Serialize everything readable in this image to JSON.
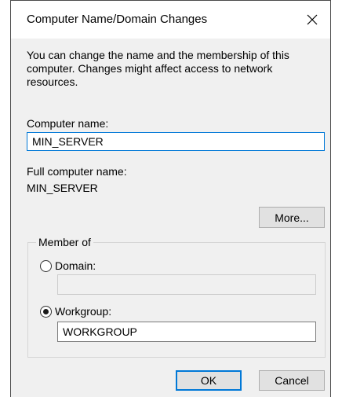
{
  "dialog": {
    "title": "Computer Name/Domain Changes",
    "close_glyph": "✕",
    "description": "You can change the name and the membership of this computer. Changes might affect access to network resources."
  },
  "computer_name": {
    "label": "Computer name:",
    "value": "MIN_SERVER"
  },
  "full_name": {
    "label": "Full computer name:",
    "value": "MIN_SERVER"
  },
  "buttons": {
    "more": "More...",
    "ok": "OK",
    "cancel": "Cancel"
  },
  "member_of": {
    "legend": "Member of",
    "domain": {
      "label": "Domain:",
      "value": "",
      "selected": false
    },
    "workgroup": {
      "label": "Workgroup:",
      "value": "WORKGROUP",
      "selected": true
    }
  },
  "colors": {
    "accent": "#0078d7",
    "dialog_bg": "#f0f0f0"
  },
  "icons": {
    "close": "close-icon"
  }
}
